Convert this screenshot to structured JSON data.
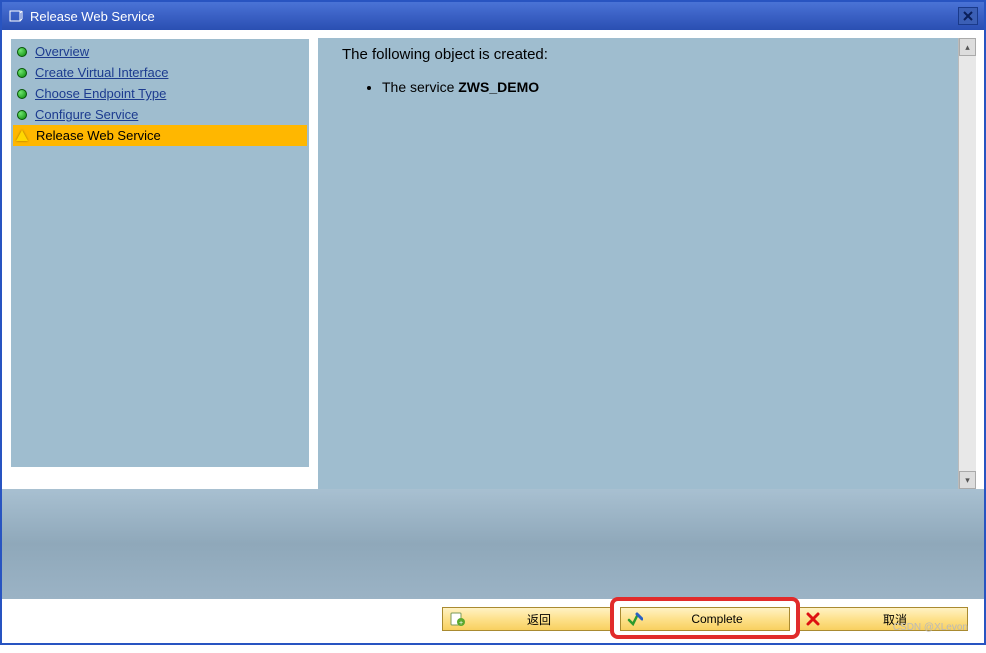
{
  "titlebar": {
    "title": "Release Web Service"
  },
  "sidebar": {
    "items": [
      {
        "label": "Overview",
        "status": "done"
      },
      {
        "label": "Create Virtual Interface",
        "status": "done"
      },
      {
        "label": "Choose Endpoint Type",
        "status": "done"
      },
      {
        "label": "Configure Service",
        "status": "done"
      },
      {
        "label": "Release Web Service",
        "status": "current"
      }
    ]
  },
  "detail": {
    "heading": "The following object is created:",
    "service_prefix": "The service ",
    "service_name": "ZWS_DEMO"
  },
  "buttons": {
    "back": "返回",
    "complete": "Complete",
    "cancel": "取消"
  },
  "watermark": "CSDN @XLevon"
}
